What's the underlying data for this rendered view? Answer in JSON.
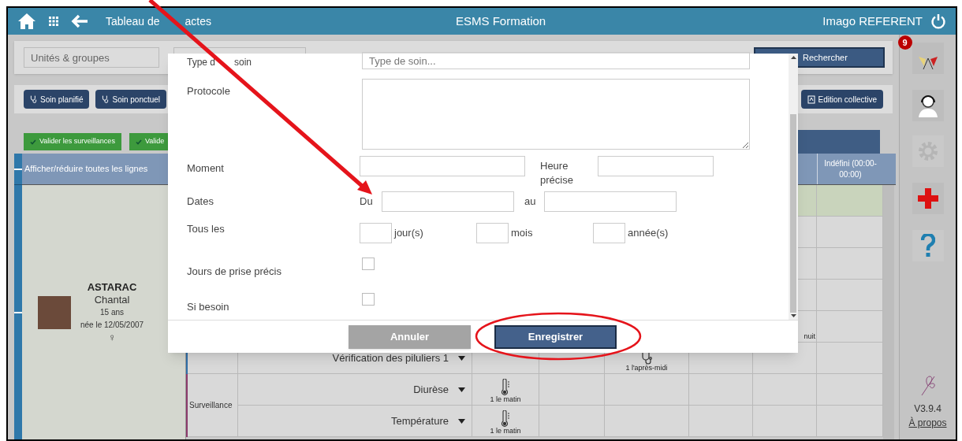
{
  "header": {
    "title_parts": [
      "Tableau de",
      "actes"
    ],
    "center": "ESMS Formation",
    "user": "Imago REFERENT"
  },
  "filters": {
    "units_placeholder": "Unités & groupes",
    "search_button": "Rechercher"
  },
  "toolbar": {
    "left_buttons": [
      "Soin planifié",
      "Soin ponctuel"
    ],
    "right_button": "Edition collective"
  },
  "validation_buttons": [
    "Valider les surveillances",
    "Valide"
  ],
  "table": {
    "toggle_all": "Afficher/réduire toutes les lignes",
    "last_column": "Indéfini (00:00-00:00)",
    "patient": {
      "last_name": "ASTARAC",
      "first_name": "Chantal",
      "age": "15 ans",
      "birth": "née le 12/05/2007",
      "sex": "♀"
    },
    "row_groups": [
      {
        "color": "#2f6fa8",
        "rows": [
          {
            "highlighted": true
          },
          {
            "highlighted": false
          },
          {
            "highlighted": false
          },
          {
            "highlighted": false
          },
          {
            "highlighted": false,
            "cells": [
              null,
              null,
              null,
              null,
              {
                "kind": "text",
                "text": "nuit"
              },
              null
            ]
          },
          {
            "highlighted": false,
            "act": "Vérification des piluliers 1",
            "cells": [
              null,
              null,
              {
                "kind": "stethoscope",
                "text": "1 l'après-midi"
              },
              null,
              null,
              null
            ]
          }
        ]
      },
      {
        "label": "Surveillance",
        "color": "#8b3a6b",
        "rows": [
          {
            "highlighted": false,
            "act": "Diurèse",
            "cells": [
              {
                "kind": "thermometer",
                "text": "1 le matin"
              },
              null,
              null,
              null,
              null,
              null
            ]
          },
          {
            "highlighted": false,
            "act": "Température",
            "cells": [
              {
                "kind": "thermometer",
                "text": "1 le matin"
              },
              null,
              null,
              null,
              null,
              null
            ]
          }
        ]
      }
    ]
  },
  "sidebar": {
    "notification_count": "9",
    "version": "V3.9.4",
    "about_link": "À propos"
  },
  "dialog": {
    "fields": [
      {
        "kind": "text",
        "label_parts": [
          "Type d",
          "soin"
        ],
        "placeholder": "Type de soin..."
      },
      {
        "kind": "textarea",
        "label": "Protocole"
      },
      {
        "kind": "pair",
        "label": "Moment",
        "second_label": "Heure précise"
      },
      {
        "kind": "range",
        "label": "Dates",
        "from": "Du",
        "to": "au"
      },
      {
        "kind": "period",
        "label": "Tous les",
        "units": [
          "jour(s)",
          "mois",
          "année(s)"
        ]
      },
      {
        "kind": "checkbox",
        "label": "Jours de prise précis",
        "checked": false
      },
      {
        "kind": "checkbox",
        "label": "Si besoin",
        "checked": false
      }
    ],
    "cancel": "Annuler",
    "save": "Enregistrer"
  },
  "annotations": {
    "arrow": true,
    "ellipse": true
  }
}
